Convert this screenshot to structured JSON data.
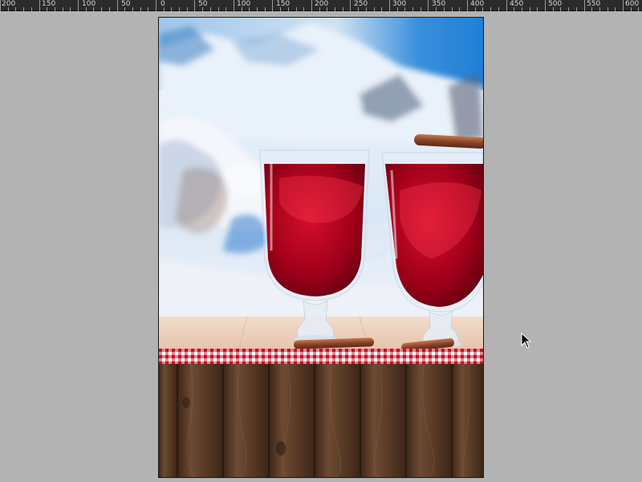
{
  "ruler": {
    "labels": [
      "200",
      "150",
      "100",
      "50",
      "0",
      "50",
      "100",
      "150",
      "200",
      "250",
      "300",
      "350",
      "400",
      "450",
      "500",
      "550",
      "600"
    ]
  },
  "colors": {
    "canvas_background": "#b3b3b3",
    "ruler_background": "#2b2b2b",
    "mulled_wine": "#a3001a",
    "gingham_red": "#d7192f",
    "wood_brown": "#5a3b25",
    "sky_blue": "#1f7fd6"
  },
  "icons": {
    "cursor": "arrow-pointer-icon"
  }
}
